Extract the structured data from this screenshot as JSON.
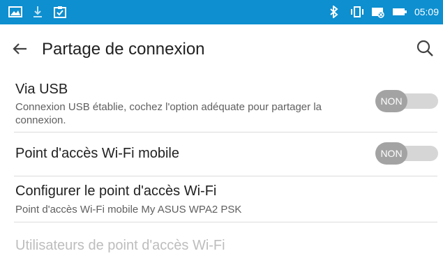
{
  "status_bar": {
    "left_icons": [
      "image-icon",
      "download-icon",
      "clipboard-check-icon"
    ],
    "right_icons": [
      "bluetooth-icon",
      "vibrate-icon",
      "battery-saver-icon",
      "battery-icon"
    ],
    "time": "05:09",
    "background": "#0d8fd0"
  },
  "app_bar": {
    "back_icon": "arrow-left-icon",
    "title": "Partage de connexion",
    "search_icon": "search-icon"
  },
  "settings": [
    {
      "title": "Via USB",
      "summary": "Connexion USB établie, cochez l'option adéquate pour partager la connexion.",
      "switch_label": "NON",
      "switch_on": false
    },
    {
      "title": "Point d'accès Wi-Fi mobile",
      "switch_label": "NON",
      "switch_on": false
    },
    {
      "title": "Configurer le point d'accès Wi-Fi",
      "summary": "Point d'accès Wi-Fi mobile My ASUS WPA2 PSK"
    },
    {
      "title": "Utilisateurs de point d'accès Wi-Fi",
      "enabled": false
    }
  ],
  "colors": {
    "text_primary": "#212121",
    "text_secondary": "#5f5f5f",
    "text_disabled": "#bdbdbd",
    "switch_thumb": "#a3a3a3",
    "switch_track": "#d6d6d6",
    "divider": "#dcdcdc"
  }
}
